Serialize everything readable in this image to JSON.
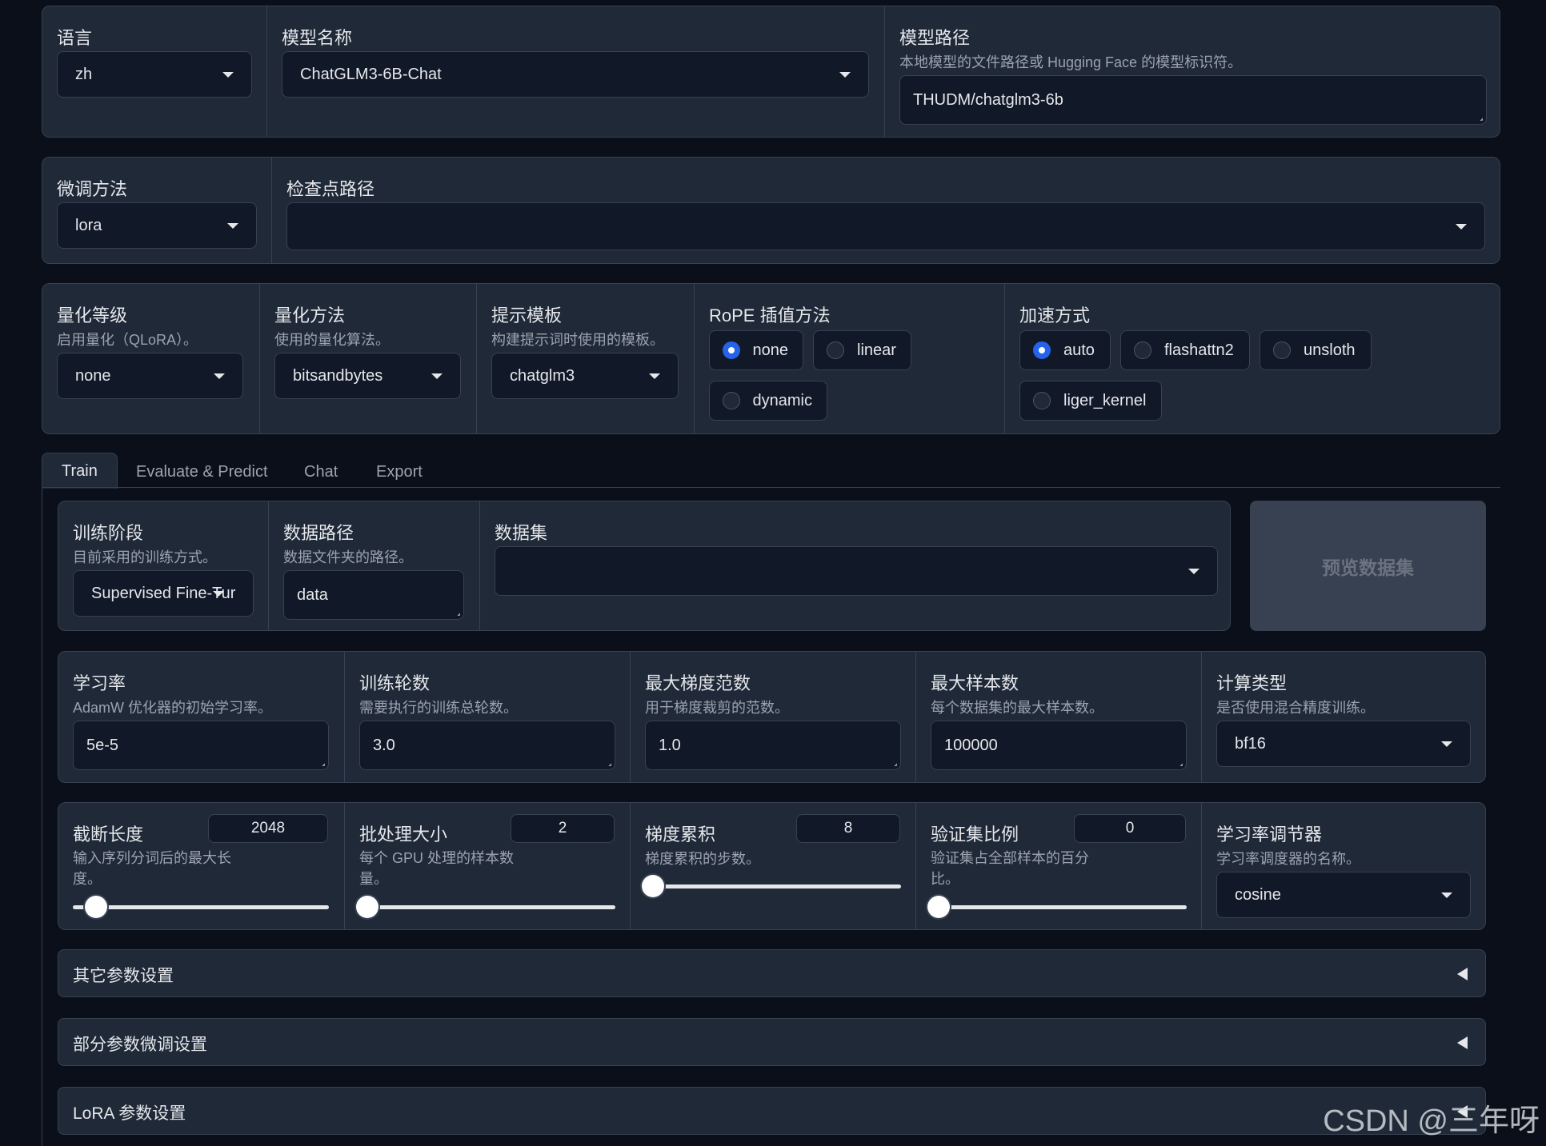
{
  "top": {
    "language": {
      "label": "语言",
      "value": "zh"
    },
    "model_name": {
      "label": "模型名称",
      "value": "ChatGLM3-6B-Chat"
    },
    "model_path": {
      "label": "模型路径",
      "info": "本地模型的文件路径或 Hugging Face 的模型标识符。",
      "value": "THUDM/chatglm3-6b"
    }
  },
  "finetune": {
    "method": {
      "label": "微调方法",
      "value": "lora"
    },
    "checkpoint": {
      "label": "检查点路径",
      "value": ""
    }
  },
  "advanced": {
    "quant_bit": {
      "label": "量化等级",
      "info": "启用量化（QLoRA）。",
      "value": "none"
    },
    "quant_method": {
      "label": "量化方法",
      "info": "使用的量化算法。",
      "value": "bitsandbytes"
    },
    "template": {
      "label": "提示模板",
      "info": "构建提示词时使用的模板。",
      "value": "chatglm3"
    },
    "rope": {
      "label": "RoPE 插值方法",
      "options": [
        "none",
        "linear",
        "dynamic"
      ],
      "selected": "none"
    },
    "booster": {
      "label": "加速方式",
      "options": [
        "auto",
        "flashattn2",
        "unsloth",
        "liger_kernel"
      ],
      "selected": "auto"
    }
  },
  "tabs": [
    "Train",
    "Evaluate & Predict",
    "Chat",
    "Export"
  ],
  "train": {
    "stage": {
      "label": "训练阶段",
      "info": "目前采用的训练方式。",
      "value": "Supervised Fine-Tur"
    },
    "dataset_dir": {
      "label": "数据路径",
      "info": "数据文件夹的路径。",
      "value": "data"
    },
    "dataset": {
      "label": "数据集",
      "value": ""
    },
    "preview_button": "预览数据集",
    "learning_rate": {
      "label": "学习率",
      "info": "AdamW 优化器的初始学习率。",
      "value": "5e-5"
    },
    "num_epochs": {
      "label": "训练轮数",
      "info": "需要执行的训练总轮数。",
      "value": "3.0"
    },
    "max_grad_norm": {
      "label": "最大梯度范数",
      "info": "用于梯度裁剪的范数。",
      "value": "1.0"
    },
    "max_samples": {
      "label": "最大样本数",
      "info": "每个数据集的最大样本数。",
      "value": "100000"
    },
    "compute_type": {
      "label": "计算类型",
      "info": "是否使用混合精度训练。",
      "value": "bf16"
    },
    "cutoff_len": {
      "label": "截断长度",
      "info": "输入序列分词后的最大长度。",
      "value": "2048",
      "level": 0.06
    },
    "batch_size": {
      "label": "批处理大小",
      "info": "每个 GPU 处理的样本数量。",
      "value": "2",
      "level": 0.0
    },
    "grad_accum": {
      "label": "梯度累积",
      "info": "梯度累积的步数。",
      "value": "8",
      "level": 0.0
    },
    "val_size": {
      "label": "验证集比例",
      "info": "验证集占全部样本的百分比。",
      "value": "0",
      "level": 0.0
    },
    "lr_scheduler": {
      "label": "学习率调节器",
      "info": "学习率调度器的名称。",
      "value": "cosine"
    }
  },
  "accordions": [
    "其它参数设置",
    "部分参数微调设置",
    "LoRA 参数设置"
  ],
  "watermark": "CSDN @三年呀"
}
